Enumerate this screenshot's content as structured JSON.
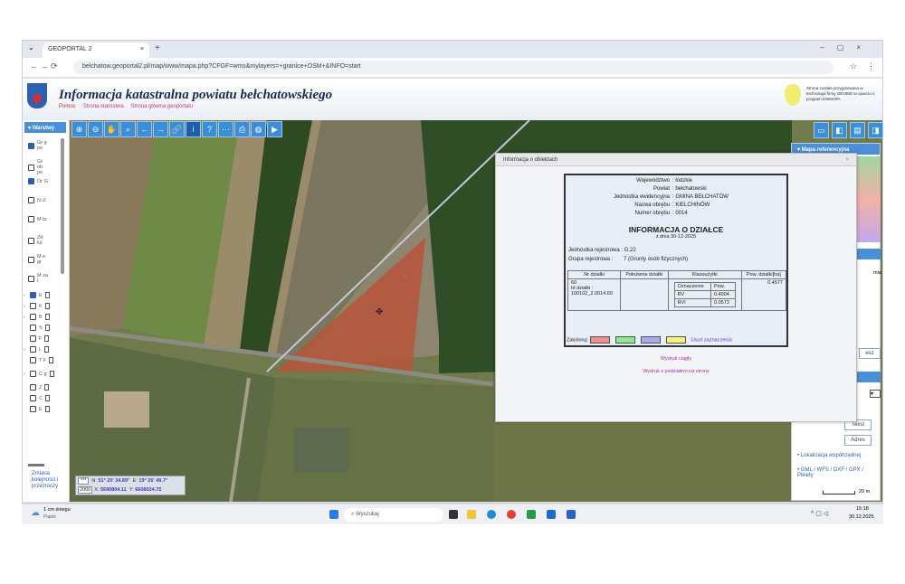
{
  "browser": {
    "tab_title": "GEOPORTAL 2",
    "url": "belchatow.geoportal2.pl/map/www/mapa.php?CFGF=wms&mylayers=+granice+OSM+&INFO=start"
  },
  "header": {
    "title": "Informacja katastralna powiatu bełchatowskiego",
    "links": [
      "Pomoc",
      "Strona starostwa",
      "Strona główna geoportalu"
    ],
    "credit": "Strona została przygotowana w technologii firmy GEOBID w oparciu o program EWMAPA",
    "logo_text": "GEOBID"
  },
  "sidebar": {
    "header": "Warstwy",
    "layers": [
      {
        "label": "Gr g po",
        "checked": true
      },
      {
        "label": "Gr ob po",
        "checked": false
      },
      {
        "label": "Or G",
        "checked": true
      },
      {
        "label": "N cl",
        "checked": false
      },
      {
        "label": "M to",
        "checked": false
      },
      {
        "label": "Zd lul",
        "checked": false
      },
      {
        "label": "M e gr",
        "checked": false
      },
      {
        "label": "M za t",
        "checked": false
      }
    ],
    "groups": [
      {
        "label": "E",
        "checked": true,
        "expand": true
      },
      {
        "label": "K",
        "checked": false,
        "expand": true
      },
      {
        "label": "B",
        "checked": false,
        "expand": true
      },
      {
        "label": "S",
        "checked": false,
        "expand": false
      },
      {
        "label": "F",
        "checked": false,
        "expand": false
      },
      {
        "label": "L",
        "checked": false,
        "expand": true
      },
      {
        "label": "T F",
        "checked": false,
        "expand": false
      },
      {
        "label": "C g",
        "checked": false,
        "expand": true
      },
      {
        "label": "Z",
        "checked": false,
        "expand": false
      },
      {
        "label": "C",
        "checked": false,
        "expand": false
      },
      {
        "label": "E",
        "checked": false,
        "expand": false
      }
    ],
    "footer_link": "Zmiana kolejności i przezroczy"
  },
  "dialog": {
    "title": "Informacja o obiektach",
    "close": "×",
    "info": [
      {
        "k": "Województwo",
        "v": "łódzkie"
      },
      {
        "k": "Powiat",
        "v": "bełchatowski"
      },
      {
        "k": "Jednostka ewidencyjna",
        "v": "GMINA BEŁCHATÓW"
      },
      {
        "k": "Nazwa obrębu",
        "v": "KIELCHINÓW"
      },
      {
        "k": "Numer obrębu",
        "v": "0014"
      }
    ],
    "heading": "INFORMACJA O DZIAŁCE",
    "date": "z dnia  30-12-2025",
    "jr_label": "Jednostka rejestrowa :",
    "jr_value": "G.22",
    "gr_label": "Grupa rejestrowa :",
    "gr_value": "7 (Grunty osób fizycznych)",
    "table": {
      "headers": [
        "Nr działki",
        "Położenie działki",
        "Klasoużytki",
        "Pow. działki[ha]"
      ],
      "nr": "60",
      "id_label": "Id działki :",
      "id": "100102_2.0014.60",
      "klas_headers": [
        "Oznaczenie",
        "Pow."
      ],
      "klas": [
        [
          "RV",
          "0.4004"
        ],
        [
          "RVI",
          "0.0573"
        ]
      ],
      "area": "0.4577"
    },
    "colorize_label": "Zakoloruj:",
    "colors": [
      "#f08c8c",
      "#8ee88e",
      "#a9a9ee",
      "#f4f47a"
    ],
    "clear": "Usuń zaznaczenia",
    "print1": "Wydruk ciągły",
    "print2": "Wydruk z podziałem na strony"
  },
  "rpanel": {
    "header": "Mapa referencyjna",
    "frag1": "mia",
    "frag2": "esz",
    "btn_teryt": "Tekst",
    "btn_adres": "Adres",
    "link1": "Lokalizacja współrzędnej",
    "link2": "GML / WFS / DXF / GPX / Pikiety",
    "scale": "20 m"
  },
  "coords": {
    "btn1": "***",
    "btn2": "2000",
    "n_label": "N:",
    "n": "51° 20' 34.89\"",
    "e_label": "E:",
    "e": "19° 26' 49.7\"",
    "x_label": "X:",
    "x": "5690804.11",
    "y_label": "Y:",
    "y": "6608024.75"
  },
  "taskbar": {
    "weather_temp": "1 cm śniegu",
    "weather_sub": "Piątek",
    "search": "Wyszukaj",
    "time": "15:18",
    "date": "30.12.2025"
  }
}
